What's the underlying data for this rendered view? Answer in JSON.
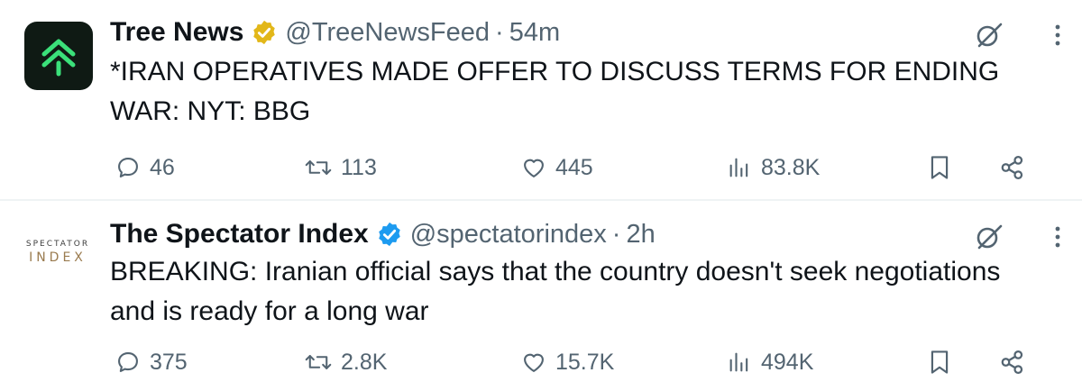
{
  "tweets": [
    {
      "author_name": "Tree News",
      "handle": "@TreeNewsFeed",
      "separator": "·",
      "time": "54m",
      "verified_badge": "gold",
      "text": "*IRAN OPERATIVES MADE OFFER TO DISCUSS TERMS FOR ENDING WAR: NYT: BBG",
      "replies": "46",
      "retweets": "113",
      "likes": "445",
      "views": "83.8K",
      "avatar_icon": "tree-news-chevrons-icon"
    },
    {
      "author_name": "The Spectator Index",
      "handle": "@spectatorindex",
      "separator": "·",
      "time": "2h",
      "verified_badge": "blue",
      "text": "BREAKING: Iranian official says that the country doesn't seek negotiations and is ready for a long war",
      "replies": "375",
      "retweets": "2.8K",
      "likes": "15.7K",
      "views": "494K",
      "avatar_line1": "SPECTATOR",
      "avatar_line2": "INDEX"
    }
  ],
  "colors": {
    "text_primary": "#0f1419",
    "text_secondary": "#536471",
    "gold_badge": "#e2b719",
    "blue_badge": "#1d9bf0",
    "tree_avatar_bg": "#0f1a14",
    "tree_avatar_icon": "#3be07a",
    "divider": "#eff3f4"
  }
}
